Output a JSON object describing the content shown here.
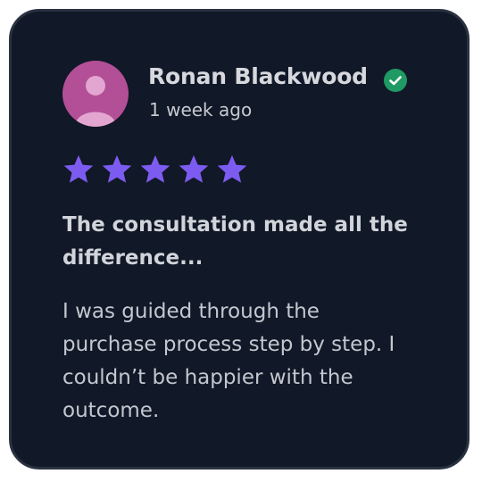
{
  "review": {
    "reviewer_name": "Ronan Blackwood",
    "time_ago": "1 week ago",
    "verified": true,
    "rating": 5,
    "rating_max": 5,
    "headline": "The consultation made all the difference...",
    "body": "I was guided through the purchase process step by step. I couldn’t be happier with the outcome."
  },
  "icons": {
    "avatar": "user-avatar-icon",
    "verified": "verified-check-icon",
    "star": "star-icon"
  },
  "colors": {
    "card_background": "#111827",
    "avatar_background": "#b24f96",
    "avatar_figure": "#e3a6d0",
    "star": "#7c5cf0",
    "verified": "#1f9a64"
  }
}
